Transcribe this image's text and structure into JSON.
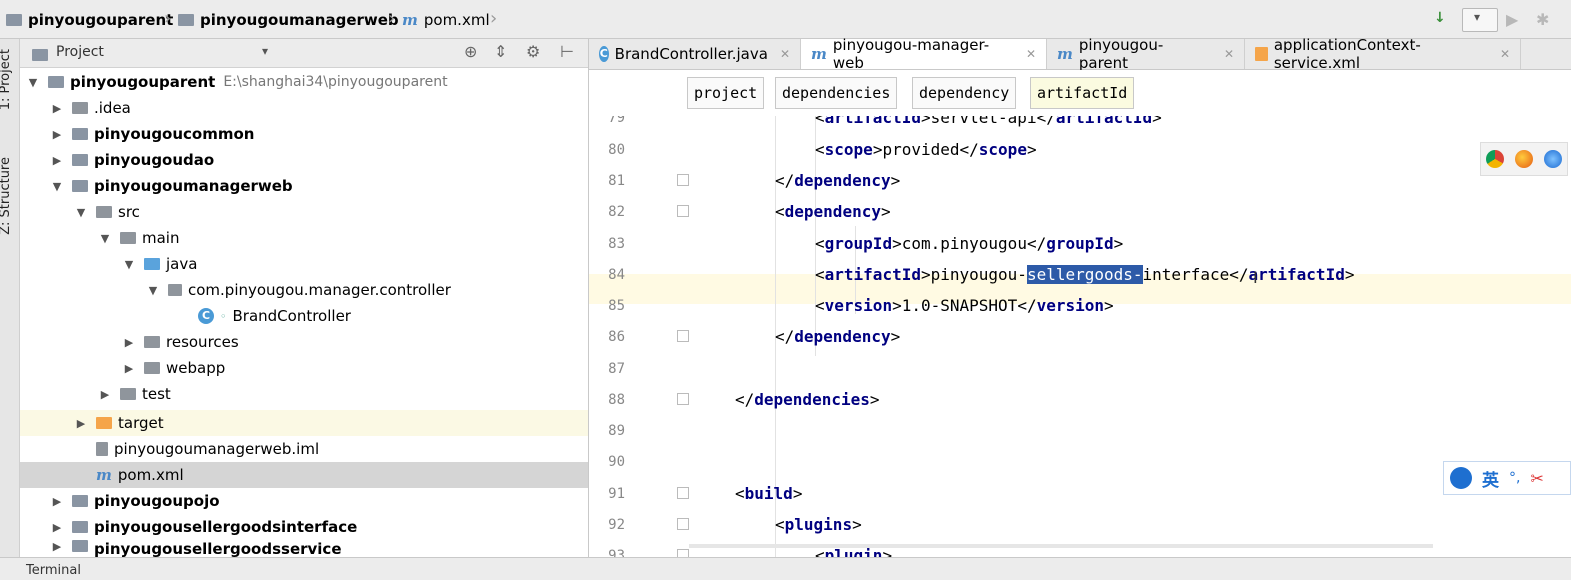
{
  "navbar": {
    "crumbs": [
      "pinyougouparent",
      "pinyougoumanagerweb",
      "pom.xml"
    ]
  },
  "left_strip": {
    "tab_project": "1: Project",
    "tab_structure": "Z: Structure"
  },
  "project_panel": {
    "title": "Project",
    "tree": [
      {
        "label": "pinyougouparent",
        "hint": "E:\\shanghai34\\pinyougouparent",
        "bold": true
      },
      {
        "label": ".idea",
        "bold": false
      },
      {
        "label": "pinyougoucommon",
        "bold": true
      },
      {
        "label": "pinyougoudao",
        "bold": true
      },
      {
        "label": "pinyougoumanagerweb",
        "bold": true
      },
      {
        "label": "src",
        "bold": false
      },
      {
        "label": "main",
        "bold": false
      },
      {
        "label": "java",
        "bold": false
      },
      {
        "label": "com.pinyougou.manager.controller",
        "bold": false
      },
      {
        "label": "BrandController",
        "bold": false
      },
      {
        "label": "resources",
        "bold": false
      },
      {
        "label": "webapp",
        "bold": false
      },
      {
        "label": "test",
        "bold": false
      },
      {
        "label": "target",
        "bold": false
      },
      {
        "label": "pinyougoumanagerweb.iml",
        "bold": false
      },
      {
        "label": "pom.xml",
        "bold": false
      },
      {
        "label": "pinyougoupojo",
        "bold": true
      },
      {
        "label": "pinyougousellergoodsinterface",
        "bold": true
      },
      {
        "label": "pinyougousellergoodsservice",
        "bold": true
      }
    ]
  },
  "editor_tabs": [
    {
      "label": "BrandController.java"
    },
    {
      "label": "pinyougou-manager-web"
    },
    {
      "label": "pinyougou-parent"
    },
    {
      "label": "applicationContext-service.xml"
    }
  ],
  "xml_breadcrumbs": [
    "project",
    "dependencies",
    "dependency",
    "artifactId"
  ],
  "code": {
    "line_numbers": [
      "79",
      "80",
      "81",
      "82",
      "83",
      "84",
      "85",
      "86",
      "87",
      "88",
      "89",
      "90",
      "91",
      "92",
      "93"
    ],
    "l79": {
      "open": "artifactId",
      "text": "servlet-api",
      "close": "artifactId"
    },
    "l80": {
      "open": "scope",
      "text": "provided",
      "close": "scope"
    },
    "l81": {
      "close": "dependency"
    },
    "l82": {
      "open": "dependency"
    },
    "l83": {
      "open": "groupId",
      "text": "com.pinyougou",
      "close": "groupId"
    },
    "l84": {
      "open": "artifactId",
      "text_before": "pinyougou-",
      "text_selected": "sellergoods-",
      "text_after": "interface",
      "close": "artifactId"
    },
    "l85": {
      "open": "version",
      "text": "1.0-SNAPSHOT",
      "close": "version"
    },
    "l86": {
      "close": "dependency"
    },
    "l88": {
      "close": "dependencies"
    },
    "l91": {
      "open": "build"
    },
    "l92": {
      "open": "plugins"
    },
    "l93": {
      "open": "plugin"
    }
  },
  "ime": {
    "label": "英"
  },
  "statusbar": {
    "label": "Terminal"
  }
}
